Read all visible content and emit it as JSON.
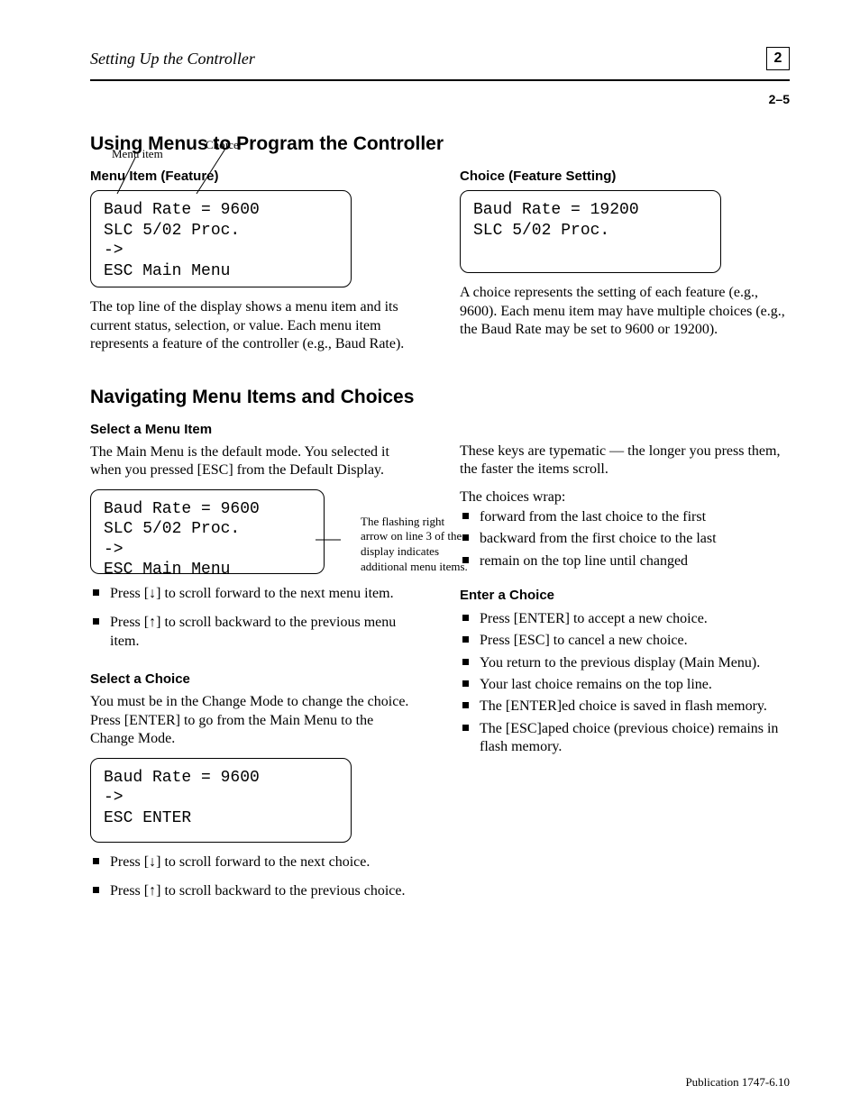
{
  "header": {
    "breadcrumb": "Setting Up the Controller",
    "chapter_box": "2",
    "page_number": "2–5"
  },
  "sections": {
    "using_menus": {
      "title": "Using Menus to Program the Controller",
      "left": {
        "subhead": "Menu Item (Feature)",
        "anno_menu_item": "Menu item",
        "anno_choice": "Choice",
        "lcd": "Baud Rate = 9600\nSLC 5/02 Proc.\n->\nESC Main Menu",
        "para": "The top line of the display shows a menu item and its current status, selection, or value.  Each menu item represents a feature of the controller (e.g., Baud Rate)."
      },
      "right": {
        "subhead": "Choice (Feature Setting)",
        "lcd": "Baud Rate = 19200\nSLC 5/02 Proc.",
        "para": "A choice represents the setting of each feature (e.g., 9600).  Each menu item may have multiple choices (e.g., the Baud Rate may be set to 9600 or 19200)."
      }
    },
    "navigating": {
      "title": "Navigating Menu Items and Choices",
      "left": {
        "subhead": "Select a Menu Item",
        "para_intro": "The Main Menu is the default mode.  You selected it when you pressed [ESC] from the Default Display.",
        "lcd": "Baud Rate = 9600\nSLC 5/02 Proc.\n->\nESC Main Menu",
        "anno_right": "The flashing right arrow on line 3 of the display indicates additional menu items.",
        "bullets": [
          "Press [↓] to scroll forward to the next menu item.",
          "Press [↑] to scroll backward to the previous menu item."
        ]
      },
      "right": {
        "subhead": "Select a Choice",
        "para_intro": "You must be in the Change Mode to change the choice.  Press [ENTER] to go from the Main Menu to the Change Mode.",
        "lcd": "Baud Rate = 9600\n->\nESC ENTER",
        "bullets": [
          "Press [↓] to scroll forward to the next choice.",
          "Press [↑] to scroll backward to the previous choice."
        ],
        "para_after1": "These keys are typematic — the longer you press them, the faster the items scroll.",
        "para_after2_label": "The choices wrap:",
        "wrap_list": [
          "forward from the last choice to the first",
          "backward from the first choice to the last",
          "remain on the top line until changed"
        ],
        "subhead_enter": "Enter a Choice",
        "enter_list": [
          "Press [ENTER] to accept a new choice.",
          "Press [ESC] to cancel a new choice.",
          "You return to the previous display (Main Menu).",
          "Your last choice remains on the top line.",
          "The [ENTER]ed choice is saved in flash memory.",
          "The [ESC]aped choice (previous choice) remains in flash memory."
        ]
      }
    }
  },
  "footer": "Publication 1747-6.10"
}
